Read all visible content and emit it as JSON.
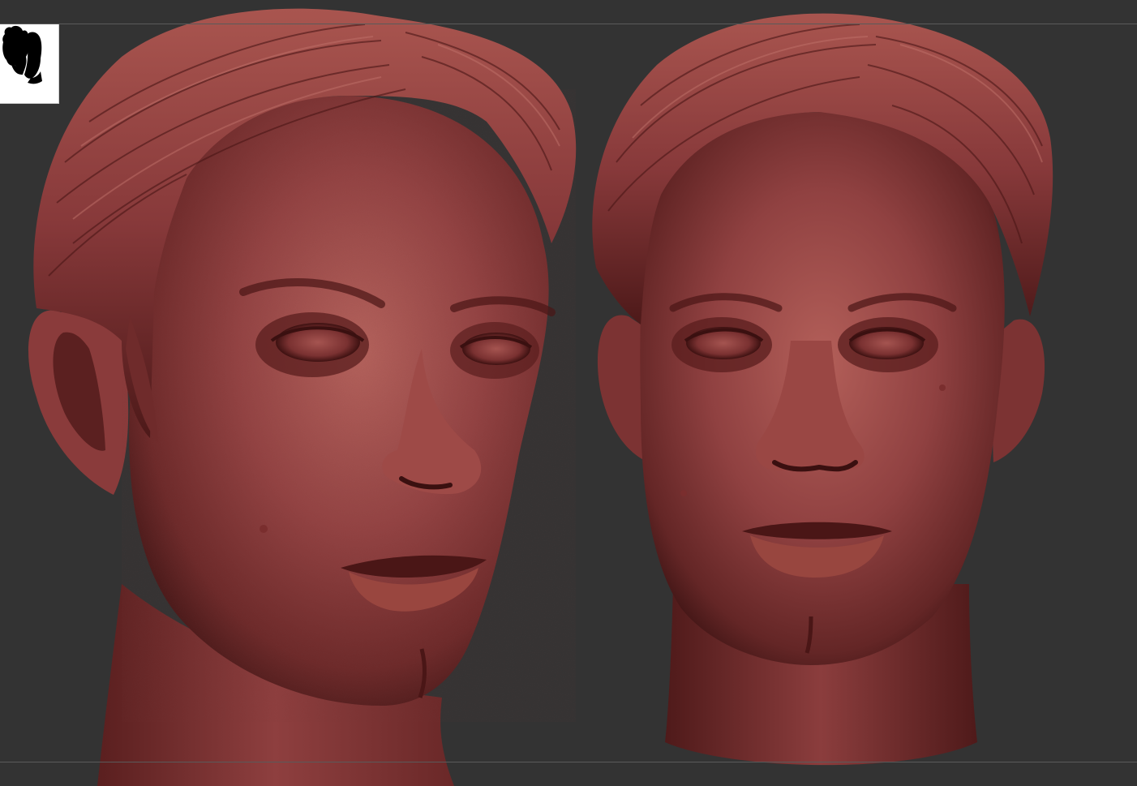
{
  "app": {
    "type": "3d-sculpting-viewport",
    "background_color": "#333333",
    "guide_line_color": "#5a5a5a"
  },
  "navigator": {
    "icon": "head-silhouette-icon",
    "background_color": "#ffffff",
    "silhouette_color": "#000000"
  },
  "sculpts": [
    {
      "name": "three-quarter-view",
      "view": "three-quarter",
      "material_color": "#8a3b3b"
    },
    {
      "name": "front-view",
      "view": "front",
      "material_color": "#8a3b3b"
    }
  ],
  "colors": {
    "material_base": "#8a3b3b",
    "material_highlight": "#b05d58",
    "material_shadow": "#3a1212",
    "material_deep": "#240808"
  }
}
